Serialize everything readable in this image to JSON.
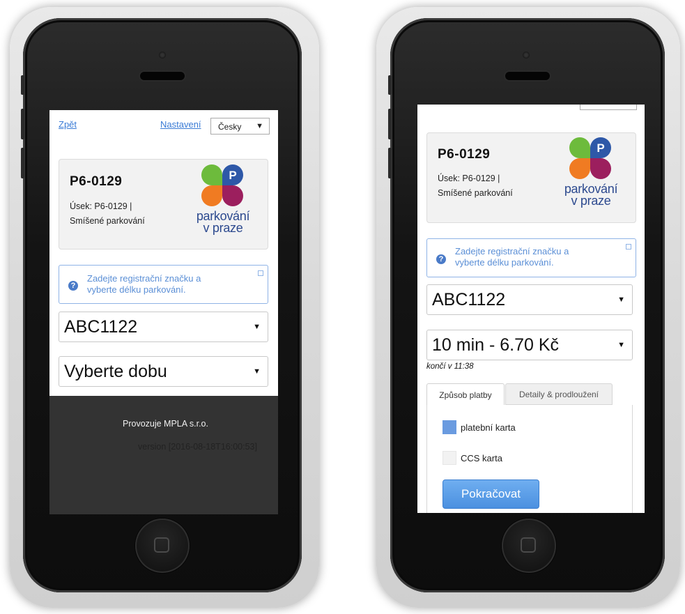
{
  "left_screen": {
    "nav": {
      "back_label": "Zpět",
      "settings_label": "Nastavení",
      "language": "Česky"
    },
    "card": {
      "code": "P6-0129",
      "section_line": "Úsek: P6-0129 |",
      "type_line": "Smíšené parkování"
    },
    "logo": {
      "line1": "parkování",
      "line2": "v praze",
      "badge": "P"
    },
    "info": {
      "line1": "Zadejte registrační značku a",
      "line2": "vyberte délku parkování."
    },
    "plate_select": "ABC1122",
    "duration_select": "Vyberte dobu",
    "footer": {
      "operator": "Provozuje MPLA s.r.o.",
      "version": "version [2016-08-18T16:00:53]"
    }
  },
  "right_screen": {
    "card": {
      "code": "P6-0129",
      "section_line": "Úsek: P6-0129 |",
      "type_line": "Smíšené parkování"
    },
    "logo": {
      "line1": "parkování",
      "line2": "v praze",
      "badge": "P"
    },
    "info": {
      "line1": "Zadejte registrační značku a",
      "line2": "vyberte délku parkování."
    },
    "plate_select": "ABC1122",
    "duration_select": "10 min - 6.70 Kč",
    "ends_at": "končí v 11:38",
    "tabs": [
      {
        "label": "Způsob platby"
      },
      {
        "label": "Detaily & prodloužení"
      }
    ],
    "payment_options": [
      {
        "label": "platební karta",
        "selected": true
      },
      {
        "label": "CCS karta",
        "selected": false
      }
    ],
    "continue_label": "Pokračovat"
  },
  "colors": {
    "link": "#3a7bd5",
    "info_text": "#5b8fd6",
    "primary_button": "#4b90e0",
    "logo_green": "#6dbb3c",
    "logo_blue": "#2e58a8",
    "logo_orange": "#f07b22",
    "logo_purple": "#9c1f5e",
    "footer_bg": "#333333"
  }
}
